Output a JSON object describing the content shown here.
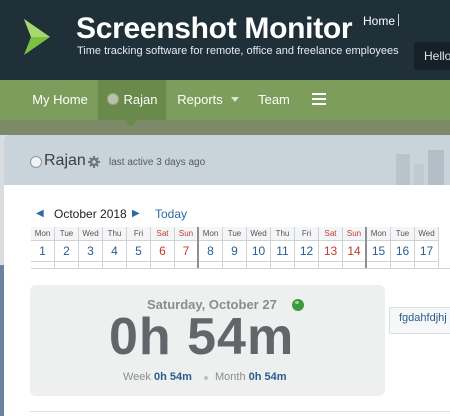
{
  "header": {
    "brand": "Screenshot Monitor",
    "tagline": "Time tracking software for remote, office and freelance employees",
    "top_link": "Home",
    "greeting": "Hello"
  },
  "nav": {
    "items": [
      {
        "label": "My Home"
      },
      {
        "label": "Rajan"
      },
      {
        "label": "Reports"
      },
      {
        "label": "Team"
      }
    ],
    "active_color": "#6a8a4b",
    "bar_color": "#7c9d5b"
  },
  "user": {
    "name": "Rajan",
    "last_active": "last active 3 days ago"
  },
  "calendar": {
    "month": "October 2018",
    "today_link": "Today",
    "days": [
      {
        "dow": "Mon",
        "num": "1"
      },
      {
        "dow": "Tue",
        "num": "2"
      },
      {
        "dow": "Wed",
        "num": "3"
      },
      {
        "dow": "Thu",
        "num": "4"
      },
      {
        "dow": "Fri",
        "num": "5"
      },
      {
        "dow": "Sat",
        "num": "6"
      },
      {
        "dow": "Sun",
        "num": "7"
      },
      {
        "dow": "Mon",
        "num": "8"
      },
      {
        "dow": "Tue",
        "num": "9"
      },
      {
        "dow": "Wed",
        "num": "10"
      },
      {
        "dow": "Thu",
        "num": "11"
      },
      {
        "dow": "Fri",
        "num": "12"
      },
      {
        "dow": "Sat",
        "num": "13"
      },
      {
        "dow": "Sun",
        "num": "14"
      },
      {
        "dow": "Mon",
        "num": "15"
      },
      {
        "dow": "Tue",
        "num": "16"
      },
      {
        "dow": "Wed",
        "num": "17"
      }
    ]
  },
  "summary": {
    "date": "Saturday, October 27",
    "time": "0h 54m",
    "week_label": "Week",
    "week_value": "0h 54m",
    "month_label": "Month",
    "month_value": "0h 54m"
  },
  "side_panel": {
    "text": "fgdahfdjhj"
  }
}
